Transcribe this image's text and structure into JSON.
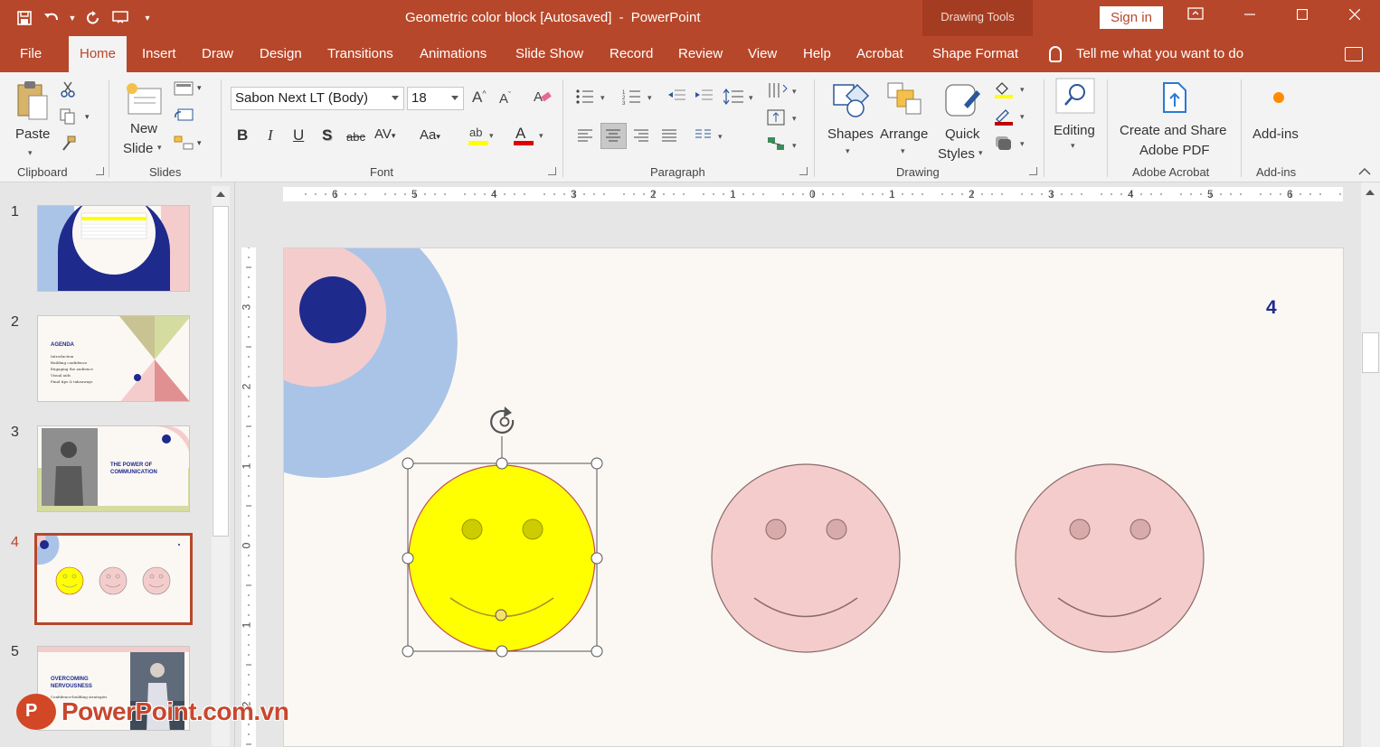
{
  "window": {
    "title_file": "Geometric color block [Autosaved]",
    "title_sep": "-",
    "title_app": "PowerPoint",
    "context_tools": "Drawing Tools",
    "sign_in": "Sign in"
  },
  "tabs": [
    "File",
    "Home",
    "Insert",
    "Draw",
    "Design",
    "Transitions",
    "Animations",
    "Slide Show",
    "Record",
    "Review",
    "View",
    "Help",
    "Acrobat",
    "Shape Format"
  ],
  "active_tab": "Home",
  "tell_me": "Tell me what you want to do",
  "ribbon": {
    "clipboard": {
      "label": "Clipboard",
      "paste": "Paste"
    },
    "slides": {
      "label": "Slides",
      "new_slide_1": "New",
      "new_slide_2": "Slide"
    },
    "font": {
      "label": "Font",
      "font_name": "Sabon Next LT (Body)",
      "font_size": "18"
    },
    "paragraph": {
      "label": "Paragraph"
    },
    "drawing": {
      "label": "Drawing",
      "shapes": "Shapes",
      "arrange": "Arrange",
      "quick_1": "Quick",
      "quick_2": "Styles"
    },
    "editing": {
      "label": "Editing"
    },
    "acrobat": {
      "label": "Adobe Acrobat",
      "create_1": "Create and Share",
      "create_2": "Adobe PDF"
    },
    "addins": {
      "label": "Add-ins",
      "button": "Add-ins"
    }
  },
  "thumbnails": [
    {
      "num": "1"
    },
    {
      "num": "2",
      "title": "AGENDA",
      "items": [
        "Introduction",
        "Building confidence",
        "Engaging the audience",
        "Visual aids",
        "Final tips & takeaways"
      ]
    },
    {
      "num": "3",
      "title_1": "THE POWER OF",
      "title_2": "COMMUNICATION"
    },
    {
      "num": "4"
    },
    {
      "num": "5",
      "title_1": "OVERCOMING",
      "title_2": "NERVOUSNESS",
      "sub": "Confidence-building strategies"
    }
  ],
  "active_slide": "4",
  "slide": {
    "number": "4"
  },
  "ruler": {
    "h": [
      "6",
      "5",
      "4",
      "3",
      "2",
      "1",
      "0",
      "1",
      "2",
      "3",
      "4",
      "5",
      "6"
    ],
    "v": [
      "3",
      "2",
      "1",
      "0",
      "1",
      "2"
    ]
  },
  "watermark": "PowerPoint.com.vn",
  "colors": {
    "accent": "#b7472a",
    "navy": "#1e2a8c",
    "light_blue": "#aac4e8",
    "pink": "#f5cccc",
    "yellow": "#ffff00"
  }
}
